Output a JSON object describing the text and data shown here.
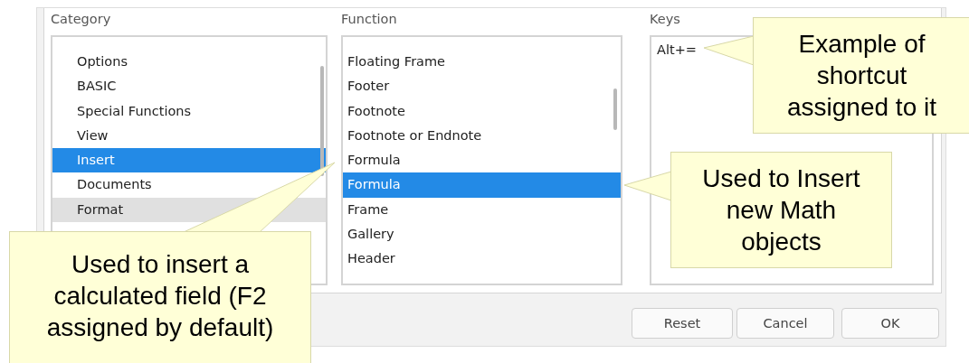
{
  "category": {
    "label": "Category",
    "items": [
      {
        "label": "Options",
        "selected": false,
        "highlighted": false
      },
      {
        "label": "BASIC",
        "selected": false,
        "highlighted": false
      },
      {
        "label": "Special Functions",
        "selected": false,
        "highlighted": false
      },
      {
        "label": "View",
        "selected": false,
        "highlighted": false
      },
      {
        "label": "Insert",
        "selected": true,
        "highlighted": false
      },
      {
        "label": "Documents",
        "selected": false,
        "highlighted": false
      },
      {
        "label": "Format",
        "selected": false,
        "highlighted": true
      }
    ]
  },
  "function": {
    "label": "Function",
    "items": [
      {
        "label": "Floating Frame",
        "selected": false
      },
      {
        "label": "Footer",
        "selected": false
      },
      {
        "label": "Footnote",
        "selected": false
      },
      {
        "label": "Footnote or Endnote",
        "selected": false
      },
      {
        "label": "Formula",
        "selected": false
      },
      {
        "label": "Formula",
        "selected": true
      },
      {
        "label": "Frame",
        "selected": false
      },
      {
        "label": "Gallery",
        "selected": false
      },
      {
        "label": "Header",
        "selected": false
      }
    ]
  },
  "keys": {
    "label": "Keys",
    "items": [
      "Alt+="
    ]
  },
  "buttons": [
    "Reset",
    "Cancel",
    "OK"
  ],
  "callouts": [
    {
      "text": "Used to insert a calculated field (F2 assigned by default)"
    },
    {
      "text": "Used to Insert new Math objects"
    },
    {
      "text": "Example of shortcut assigned to it"
    }
  ]
}
